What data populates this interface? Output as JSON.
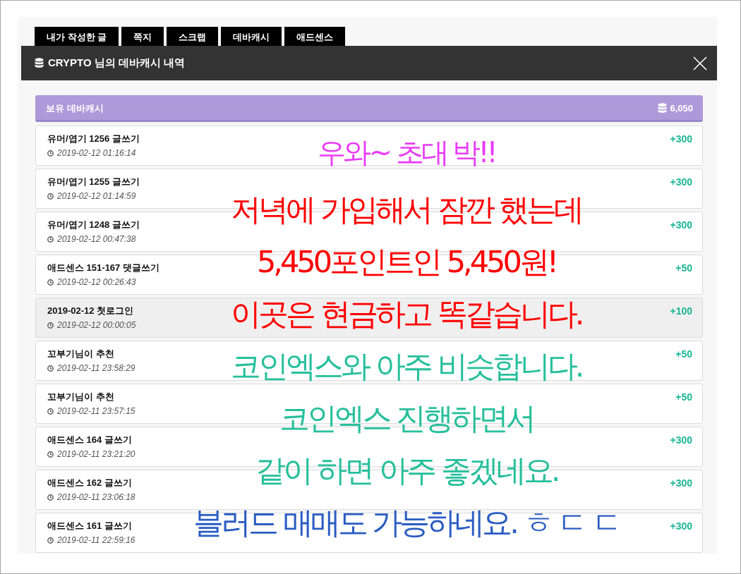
{
  "tabs": [
    {
      "label": "내가 작성한 글",
      "selected": false
    },
    {
      "label": "쪽지",
      "selected": false
    },
    {
      "label": "스크랩",
      "selected": false
    },
    {
      "label": "데바캐시",
      "selected": false
    },
    {
      "label": "애드센스",
      "selected": false
    }
  ],
  "modal": {
    "title": "CRYPTO 님의 데바캐시 내역"
  },
  "balance": {
    "label": "보유 데바캐시",
    "amount": "6,050"
  },
  "entries": [
    {
      "title": "유머/엽기 1256 글쓰기",
      "time": "2019-02-12 01:16:14",
      "amount": "+300",
      "highlighted": false
    },
    {
      "title": "유머/엽기 1255 글쓰기",
      "time": "2019-02-12 01:14:59",
      "amount": "+300",
      "highlighted": false
    },
    {
      "title": "유머/엽기 1248 글쓰기",
      "time": "2019-02-12 00:47:38",
      "amount": "+300",
      "highlighted": false
    },
    {
      "title": "애드센스 151-167 댓글쓰기",
      "time": "2019-02-12 00:26:43",
      "amount": "+50",
      "highlighted": false
    },
    {
      "title": "2019-02-12 첫로그인",
      "time": "2019-02-12 00:00:05",
      "amount": "+100",
      "highlighted": true
    },
    {
      "title": "꼬부기님이 추천",
      "time": "2019-02-11 23:58:29",
      "amount": "+50",
      "highlighted": false
    },
    {
      "title": "꼬부기님이 추천",
      "time": "2019-02-11 23:57:15",
      "amount": "+50",
      "highlighted": false
    },
    {
      "title": "애드센스 164 글쓰기",
      "time": "2019-02-11 23:21:20",
      "amount": "+300",
      "highlighted": false
    },
    {
      "title": "애드센스 162 글쓰기",
      "time": "2019-02-11 23:06:18",
      "amount": "+300",
      "highlighted": false
    },
    {
      "title": "애드센스 161 글쓰기",
      "time": "2019-02-11 22:59:16",
      "amount": "+300",
      "highlighted": false
    }
  ],
  "overlay": [
    {
      "text": "우와~ 초대 박!!",
      "color": "#e93cf6"
    },
    {
      "text": "저녁에 가입해서 잠깐 했는데",
      "color": "#ff0000"
    },
    {
      "text": "5,450포인트인 5,450원!",
      "color": "#ff0000"
    },
    {
      "text": "이곳은 현금하고 똑같습니다.",
      "color": "#ff0000"
    },
    {
      "text": "코인엑스와 아주 비슷합니다.",
      "color": "#26bf9c"
    },
    {
      "text": "코인엑스 진행하면서",
      "color": "#26bf9c"
    },
    {
      "text": "같이 하면 아주 좋겠네요.",
      "color": "#26bf9c"
    },
    {
      "text": "블러드 매매도 가능하네요. ㅎ ㄷ ㄷ",
      "color": "#2a5cc2"
    }
  ]
}
